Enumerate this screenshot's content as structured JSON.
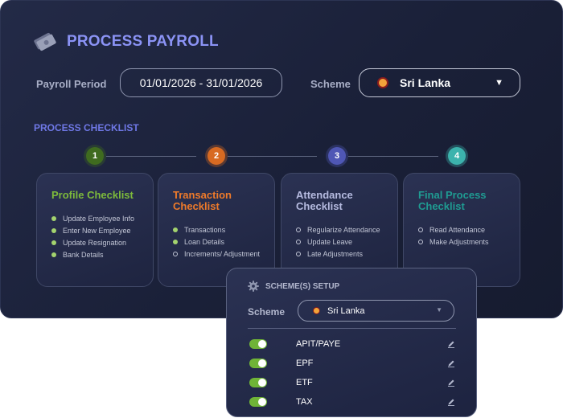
{
  "header": {
    "title": "PROCESS PAYROLL",
    "icon": "money-icon"
  },
  "period": {
    "label": "Payroll Period",
    "value": "01/01/2026 - 31/01/2026"
  },
  "scheme": {
    "label": "Scheme",
    "selected": "Sri Lanka",
    "flag_icon": "sri-lanka-flag-icon"
  },
  "checklist": {
    "heading": "PROCESS CHECKLIST",
    "steps": [
      {
        "number": "1",
        "color": "#3f6b1f"
      },
      {
        "number": "2",
        "color": "#d86a22"
      },
      {
        "number": "3",
        "color": "#4f57b5"
      },
      {
        "number": "4",
        "color": "#3cb3ad"
      }
    ],
    "cards": [
      {
        "title": "Profile Checklist",
        "color": "#7dba3b",
        "items": [
          {
            "label": "Update Employee Info",
            "done": true
          },
          {
            "label": "Enter New Employee",
            "done": true
          },
          {
            "label": "Update Resignation",
            "done": true
          },
          {
            "label": "Bank Details",
            "done": true
          }
        ]
      },
      {
        "title": "Transaction Checklist",
        "color": "#ee7a2a",
        "items": [
          {
            "label": "Transactions",
            "done": true
          },
          {
            "label": "Loan Details",
            "done": true
          },
          {
            "label": "Increments/ Adjustment",
            "done": false
          }
        ]
      },
      {
        "title": "Attendance Checklist",
        "color": "#b6bbe0",
        "items": [
          {
            "label": "Regularize Attendance",
            "done": false
          },
          {
            "label": "Update Leave",
            "done": false
          },
          {
            "label": "Late Adjustments",
            "done": false
          }
        ]
      },
      {
        "title": "Final Process Checklist",
        "color": "#1f9b92",
        "items": [
          {
            "label": "Read Attendance",
            "done": false
          },
          {
            "label": "Make Adjustments",
            "done": false
          }
        ]
      }
    ]
  },
  "setup": {
    "title": "SCHEME(S) SETUP",
    "scheme_label": "Scheme",
    "scheme_value": "Sri Lanka",
    "rows": [
      {
        "label": "APIT/PAYE",
        "enabled": true
      },
      {
        "label": "EPF",
        "enabled": true
      },
      {
        "label": "ETF",
        "enabled": true
      },
      {
        "label": "TAX",
        "enabled": true
      }
    ]
  }
}
